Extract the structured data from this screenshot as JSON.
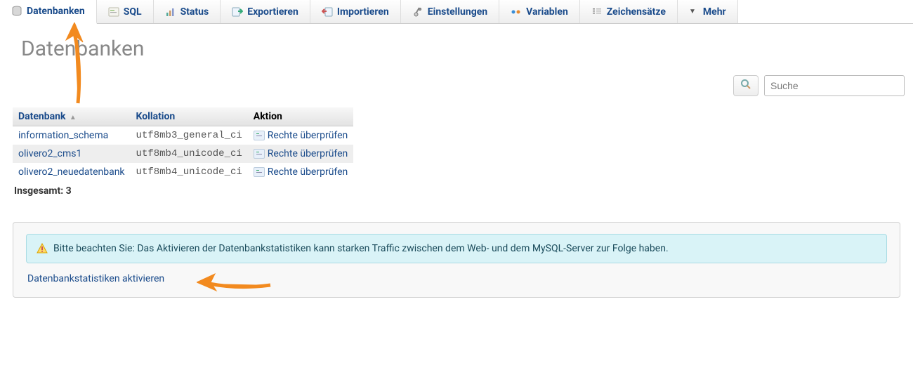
{
  "tabs": {
    "datenbanken": "Datenbanken",
    "sql": "SQL",
    "status": "Status",
    "exportieren": "Exportieren",
    "importieren": "Importieren",
    "einstellungen": "Einstellungen",
    "variablen": "Variablen",
    "zeichensaetze": "Zeichensätze",
    "mehr": "Mehr"
  },
  "heading": "Datenbanken",
  "search": {
    "placeholder": "Suche"
  },
  "table": {
    "headers": {
      "db": "Datenbank",
      "collation": "Kollation",
      "action": "Aktion"
    },
    "rows": [
      {
        "db": "information_schema",
        "collation": "utf8mb3_general_ci",
        "action": "Rechte überprüfen"
      },
      {
        "db": "olivero2_cms1",
        "collation": "utf8mb4_unicode_ci",
        "action": "Rechte überprüfen"
      },
      {
        "db": "olivero2_neuedatenbank",
        "collation": "utf8mb4_unicode_ci",
        "action": "Rechte überprüfen"
      }
    ],
    "total_label": "Insgesamt: 3"
  },
  "notice": {
    "text": "Bitte beachten Sie: Das Aktivieren der Datenbankstatistiken kann starken Traffic zwischen dem Web- und dem MySQL-Server zur Folge haben.",
    "link": "Datenbankstatistiken aktivieren"
  }
}
